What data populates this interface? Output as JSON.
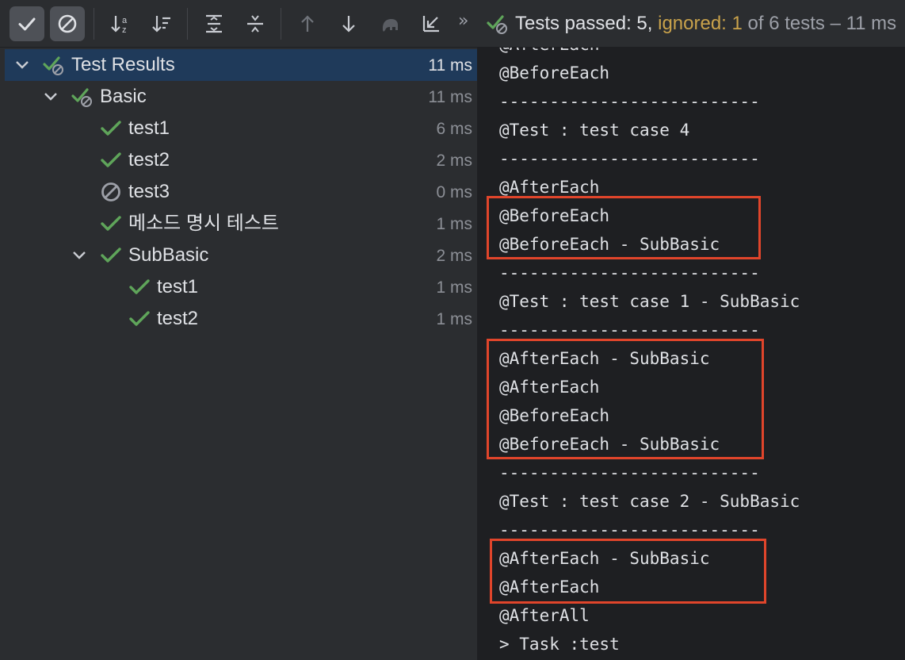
{
  "toolbar": {
    "buttons": [
      {
        "name": "show-passed-button",
        "icon": "checkmark-icon",
        "active": true
      },
      {
        "name": "show-ignored-button",
        "icon": "ignored-icon",
        "active": true
      },
      {
        "name": "sort-alphabetically-button",
        "icon": "sort-alpha-icon"
      },
      {
        "name": "sort-by-duration-button",
        "icon": "sort-duration-icon"
      },
      {
        "name": "expand-all-button",
        "icon": "expand-all-icon"
      },
      {
        "name": "collapse-all-button",
        "icon": "collapse-all-icon"
      },
      {
        "name": "previous-failed-button",
        "icon": "arrow-up-icon"
      },
      {
        "name": "next-failed-button",
        "icon": "arrow-down-icon"
      },
      {
        "name": "import-tests-button",
        "icon": "elephant-icon"
      },
      {
        "name": "export-tests-button",
        "icon": "export-arrow-icon"
      }
    ],
    "more_label": "»",
    "status": {
      "passed_text": "Tests passed: 5,",
      "ignored_text": "ignored: 1",
      "rest_text": "of 6 tests – 11 ms"
    }
  },
  "tree": [
    {
      "label": "Test Results",
      "time": "11 ms",
      "status": "passed-with-ignored",
      "expanded": true,
      "selected": true
    },
    {
      "label": "Basic",
      "time": "11 ms",
      "status": "passed-with-ignored",
      "expanded": true
    },
    {
      "label": "test1",
      "time": "6 ms",
      "status": "passed"
    },
    {
      "label": "test2",
      "time": "2 ms",
      "status": "passed"
    },
    {
      "label": "test3",
      "time": "0 ms",
      "status": "ignored"
    },
    {
      "label": "메소드 명시 테스트",
      "time": "1 ms",
      "status": "passed"
    },
    {
      "label": "SubBasic",
      "time": "2 ms",
      "status": "passed",
      "expanded": true
    },
    {
      "label": "test1",
      "time": "1 ms",
      "status": "passed"
    },
    {
      "label": "test2",
      "time": "1 ms",
      "status": "passed"
    }
  ],
  "console": {
    "lines": [
      "@AfterEach",
      "@BeforeEach",
      "--------------------------",
      "@Test : test case 4",
      "--------------------------",
      "@AfterEach",
      "@BeforeEach",
      "@BeforeEach - SubBasic",
      "--------------------------",
      "@Test : test case 1 - SubBasic",
      "--------------------------",
      "@AfterEach - SubBasic",
      "@AfterEach",
      "@BeforeEach",
      "@BeforeEach - SubBasic",
      "--------------------------",
      "@Test : test case 2 - SubBasic",
      "--------------------------",
      "@AfterEach - SubBasic",
      "@AfterEach",
      "@AfterAll",
      "> Task :test"
    ]
  },
  "colors": {
    "pass_green": "#5fa55a",
    "ignored_gray": "#9da0a8",
    "ignored_text": "#c9a24b",
    "highlight_red": "#e0452b",
    "selection": "#1f3a5a"
  }
}
